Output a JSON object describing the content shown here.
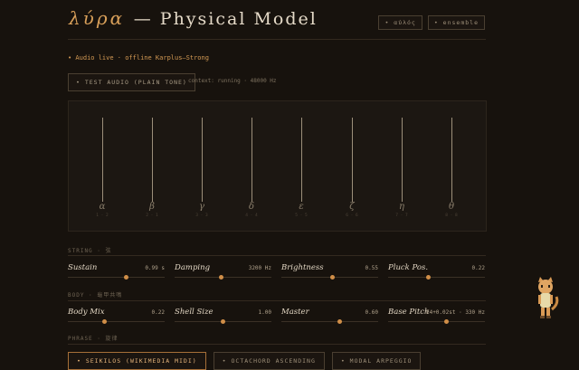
{
  "header": {
    "title_greek": "λύρα",
    "title_rest": "— Physical Model",
    "buttons": [
      {
        "label": "• αὐλός"
      },
      {
        "label": "• ensemble"
      }
    ]
  },
  "status": {
    "text": "• Audio live · offline Karplus–Strong"
  },
  "test_audio": {
    "label": "• TEST AUDIO (PLAIN TONE)",
    "context": "context: running · 48000 Hz"
  },
  "strings": [
    {
      "symbol": "α",
      "num": "1 · 2"
    },
    {
      "symbol": "β",
      "num": "2 · 1"
    },
    {
      "symbol": "γ",
      "num": "3 · 3"
    },
    {
      "symbol": "δ",
      "num": "4 · 4"
    },
    {
      "symbol": "ε",
      "num": "5 · 5"
    },
    {
      "symbol": "ζ",
      "num": "6 · 6"
    },
    {
      "symbol": "η",
      "num": "7 · 7"
    },
    {
      "symbol": "θ",
      "num": "8 · 8"
    }
  ],
  "sections": {
    "string": "STRING · 弦",
    "body": "BODY · 龜甲共鳴",
    "phrase": "PHRASE · 旋律"
  },
  "string_params": [
    {
      "label": "Sustain",
      "value": "0.99 s",
      "level": 0.6
    },
    {
      "label": "Damping",
      "value": "3200 Hz",
      "level": 0.48
    },
    {
      "label": "Brightness",
      "value": "0.55",
      "level": 0.53
    },
    {
      "label": "Pluck Pos.",
      "value": "0.22",
      "level": 0.42
    }
  ],
  "body_params": [
    {
      "label": "Body Mix",
      "value": "0.22",
      "level": 0.38
    },
    {
      "label": "Shell Size",
      "value": "1.00",
      "level": 0.5
    },
    {
      "label": "Master",
      "value": "0.60",
      "level": 0.6
    },
    {
      "label": "Base Pitch",
      "value": "E4+0.02st · 330 Hz",
      "level": 0.6
    }
  ],
  "phrase_buttons": [
    {
      "label": "• SEIKILOS (WIKIMEDIA MIDI)",
      "active": true
    },
    {
      "label": "• OCTACHORD ASCENDING",
      "active": false
    },
    {
      "label": "• MODAL ARPEGGIO",
      "active": false
    }
  ],
  "colors": {
    "background": "#17120d",
    "accent": "#d08e48",
    "text": "#e2d6c3"
  }
}
